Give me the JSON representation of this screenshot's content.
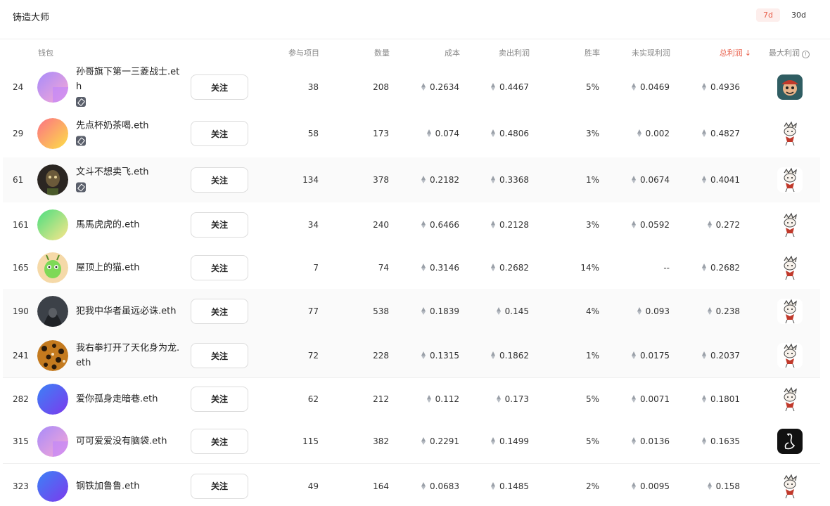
{
  "header": {
    "title": "铸造大师",
    "ranges": [
      {
        "label": "7d",
        "active": true
      },
      {
        "label": "30d",
        "active": false
      }
    ]
  },
  "columns": {
    "wallet": "钱包",
    "projects": "参与项目",
    "quantity": "数量",
    "cost": "成本",
    "sold_profit": "卖出利润",
    "win_rate": "胜率",
    "unrealized": "未实现利润",
    "total_profit": "总利润",
    "max_profit": "最大利润"
  },
  "sort": {
    "column": "total_profit",
    "direction": "desc",
    "icon": "arrow-down-icon"
  },
  "follow_label": "关注",
  "rows": [
    {
      "rank": "24",
      "name": "孙哥旗下第一三菱战士.eth",
      "badge": true,
      "projects": "38",
      "quantity": "208",
      "cost": "0.2634",
      "sold": "0.4467",
      "win": "5%",
      "unrealized": "0.0469",
      "total": "0.4936",
      "avatar": "gradient-purple-pink",
      "nft": "pirate-nft"
    },
    {
      "rank": "29",
      "name": "先点杯奶茶喝.eth",
      "badge": true,
      "projects": "58",
      "quantity": "173",
      "cost": "0.074",
      "sold": "0.4806",
      "win": "3%",
      "unrealized": "0.002",
      "total": "0.4827",
      "avatar": "gradient-pink-yellow",
      "nft": "sketch-character-nft"
    },
    {
      "rank": "61",
      "name": "文斗不想卖飞.eth",
      "badge": true,
      "projects": "134",
      "quantity": "378",
      "cost": "0.2182",
      "sold": "0.3368",
      "win": "1%",
      "unrealized": "0.0674",
      "total": "0.4041",
      "avatar": "ape-photo",
      "nft": "sketch-character-nft"
    },
    {
      "rank": "161",
      "name": "馬馬虎虎的.eth",
      "badge": false,
      "projects": "34",
      "quantity": "240",
      "cost": "0.6466",
      "sold": "0.2128",
      "win": "3%",
      "unrealized": "0.0592",
      "total": "0.272",
      "avatar": "gradient-green-yellow",
      "nft": "sketch-character-nft"
    },
    {
      "rank": "165",
      "name": "屋顶上的猫.eth",
      "badge": false,
      "projects": "7",
      "quantity": "74",
      "cost": "0.3146",
      "sold": "0.2682",
      "win": "14%",
      "unrealized": "--",
      "total": "0.2682",
      "avatar": "cartoon-alien",
      "nft": "sketch-character-nft"
    },
    {
      "rank": "190",
      "name": "犯我中华者虽远必诛.eth",
      "badge": false,
      "projects": "77",
      "quantity": "538",
      "cost": "0.1839",
      "sold": "0.145",
      "win": "4%",
      "unrealized": "0.093",
      "total": "0.238",
      "avatar": "dark-hooded",
      "nft": "sketch-character-nft"
    },
    {
      "rank": "241",
      "name": "我右拳打开了天化身为龙.eth",
      "badge": false,
      "projects": "72",
      "quantity": "228",
      "cost": "0.1315",
      "sold": "0.1862",
      "win": "1%",
      "unrealized": "0.0175",
      "total": "0.2037",
      "avatar": "leopard-pattern",
      "nft": "sketch-character-nft"
    },
    {
      "rank": "282",
      "name": "爱你孤身走暗巷.eth",
      "badge": false,
      "projects": "62",
      "quantity": "212",
      "cost": "0.112",
      "sold": "0.173",
      "win": "5%",
      "unrealized": "0.0071",
      "total": "0.1801",
      "avatar": "gradient-blue-purple",
      "nft": "sketch-character-nft"
    },
    {
      "rank": "315",
      "name": "可可爱爱没有脑袋.eth",
      "badge": false,
      "projects": "115",
      "quantity": "382",
      "cost": "0.2291",
      "sold": "0.1499",
      "win": "5%",
      "unrealized": "0.0136",
      "total": "0.1635",
      "avatar": "gradient-purple-pink",
      "nft": "swan-nft"
    },
    {
      "rank": "323",
      "name": "钢铁加鲁鲁.eth",
      "badge": false,
      "projects": "49",
      "quantity": "164",
      "cost": "0.0683",
      "sold": "0.1485",
      "win": "2%",
      "unrealized": "0.0095",
      "total": "0.158",
      "avatar": "gradient-blue-purple",
      "nft": "sketch-character-nft"
    }
  ],
  "colors": {
    "accent": "#e8604c",
    "accent_bg": "#fdeeec",
    "muted": "#888888"
  }
}
